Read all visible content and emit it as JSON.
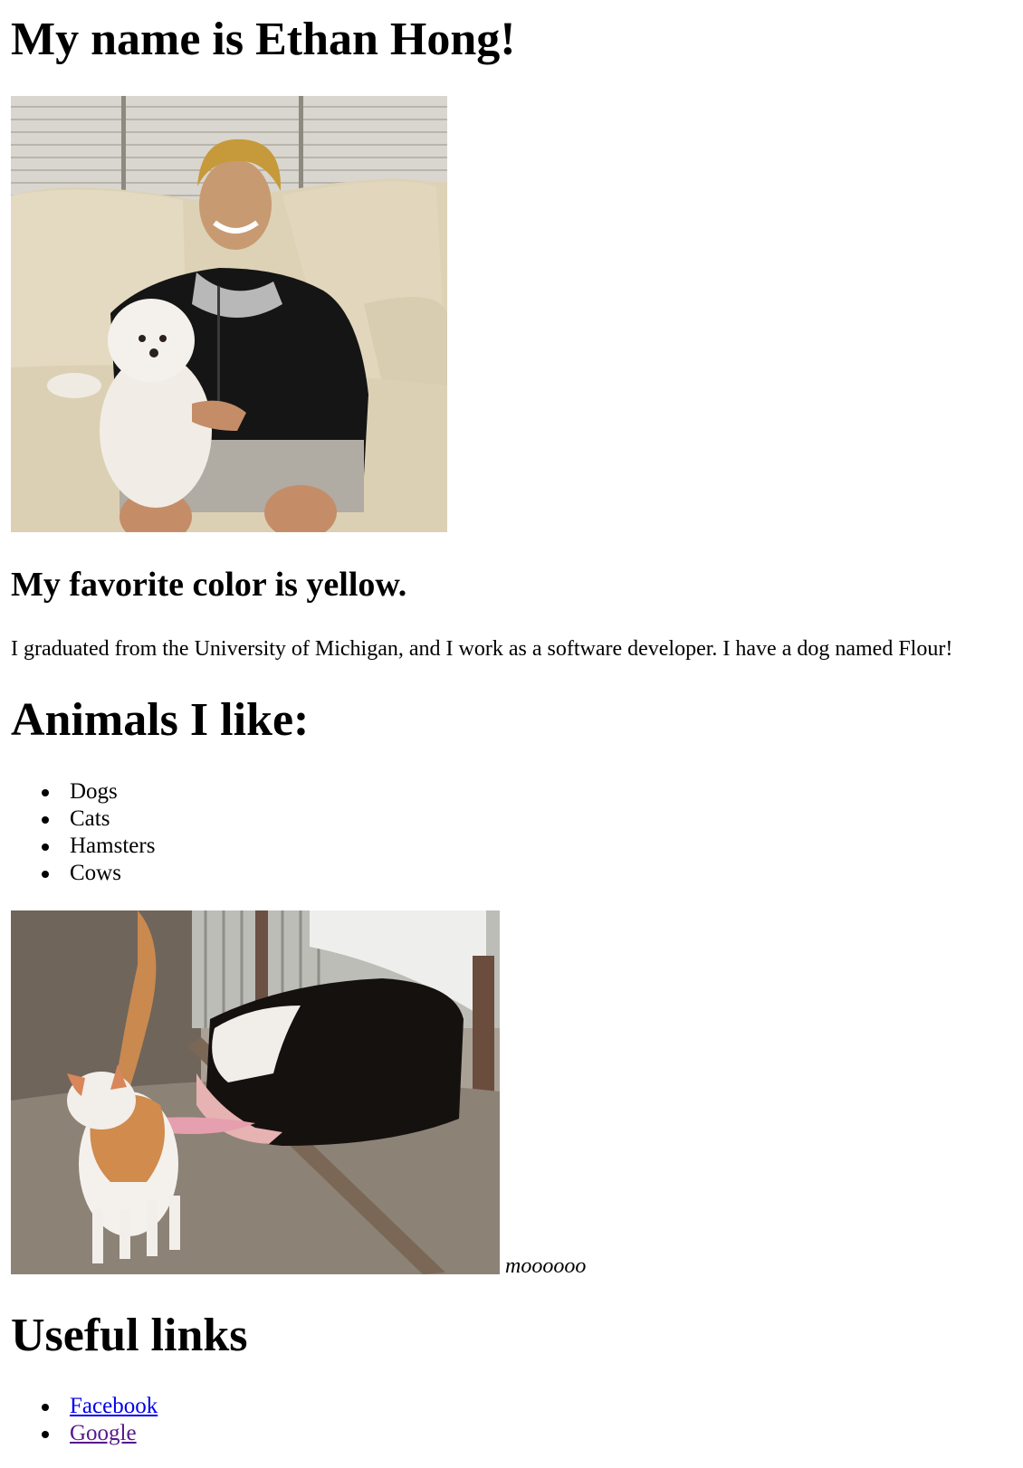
{
  "header": {
    "title": "My name is Ethan Hong!"
  },
  "profile": {
    "color_heading": "My favorite color is yellow.",
    "bio": "I graduated from the University of Michigan, and I work as a software developer. I have a dog named Flour!"
  },
  "animals": {
    "heading": "Animals I like:",
    "items": [
      "Dogs",
      "Cats",
      "Hamsters",
      "Cows"
    ],
    "caption": "moooooo"
  },
  "links": {
    "heading": "Useful links",
    "items": [
      {
        "label": "Facebook",
        "color": "#0000ee"
      },
      {
        "label": "Google",
        "color": "#551a8b"
      }
    ]
  }
}
